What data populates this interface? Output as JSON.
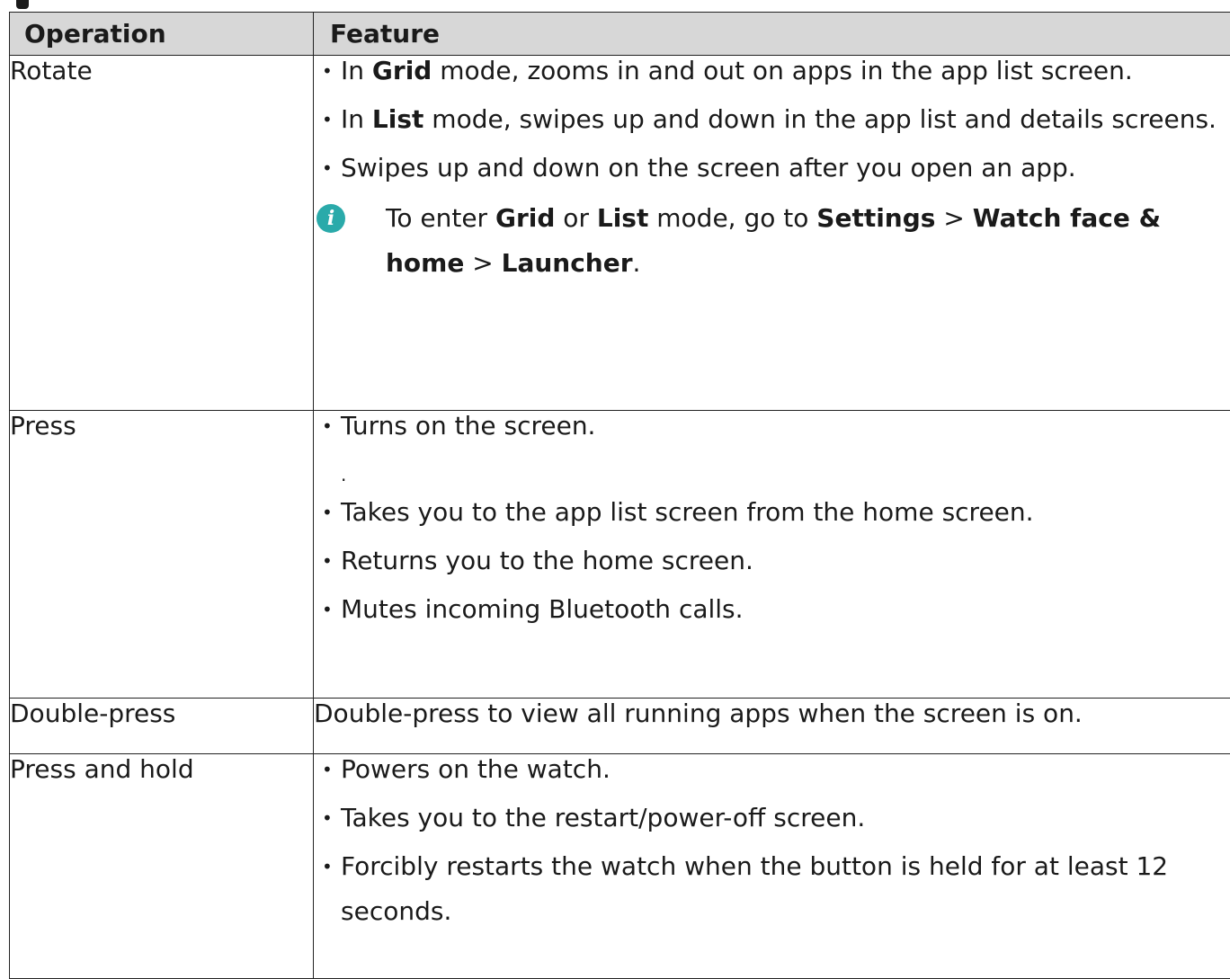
{
  "table": {
    "headers": {
      "operation": "Operation",
      "feature": "Feature"
    },
    "rows": [
      {
        "operation": "Rotate",
        "items": [
          {
            "a": "In ",
            "b": "Grid",
            "c": " mode, zooms in and out on apps in the app list screen."
          },
          {
            "a": "In ",
            "b": "List",
            "c": " mode, swipes up and down in the app list and details screens."
          },
          {
            "a": "Swipes up and down on the screen after you open an app.",
            "b": "",
            "c": ""
          }
        ],
        "note": {
          "icon": "info-icon",
          "t1": "To enter ",
          "b1": "Grid",
          "t2": " or ",
          "b2": "List",
          "t3": " mode, go to ",
          "b3": "Settings",
          "t4": " > ",
          "b4": "Watch face & home",
          "t5": " > ",
          "b5": "Launcher",
          "t6": "."
        }
      },
      {
        "operation": "Press",
        "items": [
          "Turns on the screen.",
          "",
          "Takes you to the app list screen from the home screen.",
          "Returns you to the home screen.",
          "Mutes incoming Bluetooth calls."
        ]
      },
      {
        "operation": "Double-press",
        "feature": "Double-press to view all running apps when the screen is on."
      },
      {
        "operation": "Press and hold",
        "items": [
          "Powers on the watch.",
          "Takes you to the restart/power-off screen.",
          "Forcibly restarts the watch when the button is held for at least 12 seconds."
        ]
      }
    ]
  },
  "colors": {
    "header_bg": "#d7d7d7",
    "info_icon": "#2aaaaa",
    "border": "#222222"
  }
}
